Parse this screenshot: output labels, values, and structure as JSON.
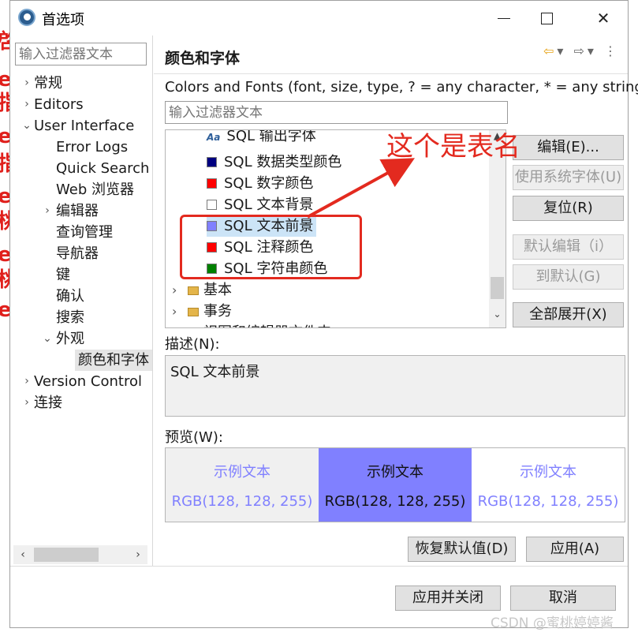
{
  "window": {
    "title": "首选项"
  },
  "left": {
    "filter_placeholder": "输入过滤器文本",
    "tree": [
      {
        "label": "常规",
        "chevron": "›"
      },
      {
        "label": "Editors",
        "chevron": "›"
      },
      {
        "label": "User Interface",
        "chevron": "⌄"
      },
      {
        "label": "Error Logs",
        "chevron": ""
      },
      {
        "label": "Quick Search",
        "chevron": ""
      },
      {
        "label": "Web 浏览器",
        "chevron": ""
      },
      {
        "label": "编辑器",
        "chevron": "›"
      },
      {
        "label": "查询管理",
        "chevron": ""
      },
      {
        "label": "导航器",
        "chevron": ""
      },
      {
        "label": "键",
        "chevron": ""
      },
      {
        "label": "确认",
        "chevron": ""
      },
      {
        "label": "搜索",
        "chevron": ""
      },
      {
        "label": "外观",
        "chevron": "⌄"
      },
      {
        "label": "颜色和字体",
        "chevron": ""
      },
      {
        "label": "Version Control",
        "chevron": "›"
      },
      {
        "label": "连接",
        "chevron": "›"
      }
    ],
    "scroll_left": "‹",
    "scroll_right": "›"
  },
  "right": {
    "title": "颜色和字体",
    "nav_icons": {
      "back": "⇦",
      "back_menu": "▾",
      "forward": "⇨",
      "forward_menu": "▾",
      "more": "⋮"
    },
    "description": "Colors and Fonts (font, size, type, ? = any character, * = any string) :",
    "filter_placeholder": "输入过滤器文本",
    "list": [
      {
        "label": "SQL  输出字体",
        "kind": "font"
      },
      {
        "label": "SQL 数据类型颜色",
        "kind": "color",
        "color": "#000080"
      },
      {
        "label": "SQL 数字颜色",
        "kind": "color",
        "color": "#ff0000"
      },
      {
        "label": "SQL 文本背景",
        "kind": "color",
        "color": "#ffffff"
      },
      {
        "label": "SQL 文本前景",
        "kind": "color",
        "color": "#8080ff"
      },
      {
        "label": "SQL 注释颜色",
        "kind": "color",
        "color": "#ff0000"
      },
      {
        "label": "SQL 字符串颜色",
        "kind": "color",
        "color": "#008000"
      },
      {
        "label": "基本",
        "kind": "folder"
      },
      {
        "label": "事务",
        "kind": "folder"
      },
      {
        "label": "视图和编辑器文件夹",
        "kind": "folder"
      }
    ],
    "buttons": {
      "edit": "编辑(E)...",
      "use_system_font": "使用系统字体(U)",
      "reset": "复位(R)",
      "edit_default": "默认编辑（i）",
      "goto_default": "到默认(G)",
      "expand_all": "全部展开(X)"
    },
    "desc_label": "描述(N):",
    "desc_text": "SQL 文本前景",
    "preview_label": "预览(W):",
    "preview": [
      {
        "sample": "示例文本",
        "rgb": "RGB(128, 128, 255)"
      },
      {
        "sample": "示例文本",
        "rgb": "RGB(128, 128, 255)"
      },
      {
        "sample": "示例文本",
        "rgb": "RGB(128, 128, 255)"
      }
    ],
    "restore_defaults": "恢复默认值(D)",
    "apply": "应用(A)"
  },
  "footer": {
    "apply_close": "应用并关闭",
    "cancel": "取消"
  },
  "annotation": {
    "text": "这个是表名"
  },
  "watermark": "CSDN @蜜桃婷婷酱",
  "colors": {
    "accent": "#8080ff",
    "annotation": "#e32a1f"
  }
}
